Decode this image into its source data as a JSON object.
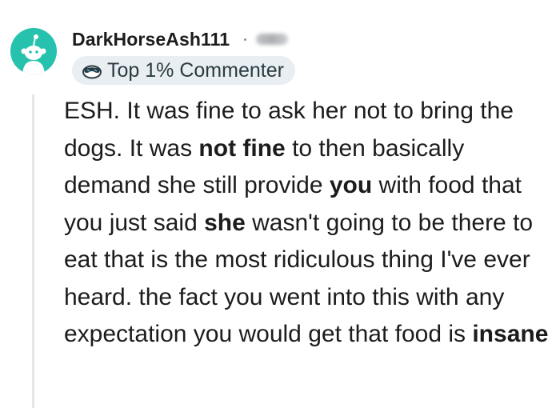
{
  "comment": {
    "author": "DarkHorseAsh111",
    "badge": {
      "icon": "sunglasses-face-icon",
      "label": "Top 1% Commenter"
    },
    "body_segments": [
      {
        "text": "ESH. It was fine to ask her not to bring the dogs. It was ",
        "bold": false
      },
      {
        "text": "not fine",
        "bold": true
      },
      {
        "text": " to then basically demand she still provide ",
        "bold": false
      },
      {
        "text": "you",
        "bold": true
      },
      {
        "text": " with food that you just said ",
        "bold": false
      },
      {
        "text": "she",
        "bold": true
      },
      {
        "text": " wasn't going to be there to eat that is the most ridiculous thing I've ever heard. the fact you went into this with any expectation you would get that food is ",
        "bold": false
      },
      {
        "text": "insane",
        "bold": true
      }
    ]
  },
  "colors": {
    "avatar_bg": "#27c2ad",
    "badge_bg": "#e9eef2",
    "text": "#1c1c1c",
    "thread_line": "#e4e6e8"
  }
}
